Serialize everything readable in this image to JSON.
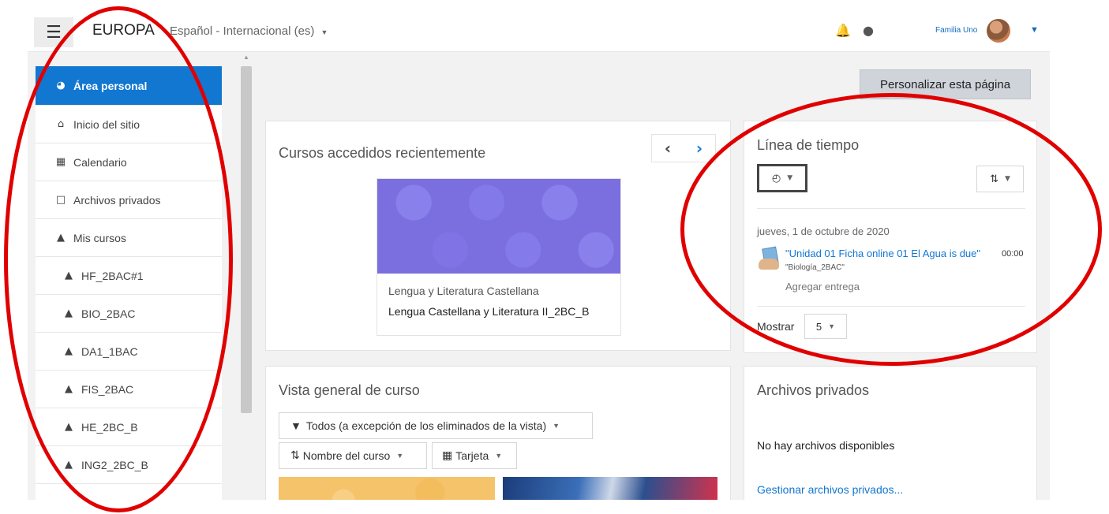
{
  "topbar": {
    "menu_icon": "hamburger-icon",
    "site_name": "EUROPA",
    "language": "Español - Internacional (es)",
    "notifications_icon": "bell-icon",
    "messages_icon": "chat-icon",
    "user_name": "Familia Uno"
  },
  "nav": {
    "items": [
      {
        "label": "Área personal",
        "icon": "dashboard-icon",
        "active": true
      },
      {
        "label": "Inicio del sitio",
        "icon": "home-icon"
      },
      {
        "label": "Calendario",
        "icon": "calendar-icon"
      },
      {
        "label": "Archivos privados",
        "icon": "file-icon"
      },
      {
        "label": "Mis cursos",
        "icon": "graduation-cap-icon"
      },
      {
        "label": "HF_2BAC#1",
        "icon": "graduation-cap-icon"
      },
      {
        "label": "BIO_2BAC",
        "icon": "graduation-cap-icon"
      },
      {
        "label": "DA1_1BAC",
        "icon": "graduation-cap-icon"
      },
      {
        "label": "FIS_2BAC",
        "icon": "graduation-cap-icon"
      },
      {
        "label": "HE_2BC_B",
        "icon": "graduation-cap-icon"
      },
      {
        "label": "ING2_2BC_B",
        "icon": "graduation-cap-icon"
      }
    ]
  },
  "page": {
    "customize_button": "Personalizar esta página"
  },
  "recent_courses": {
    "title": "Cursos accedidos recientemente",
    "course": {
      "category": "Lengua y Literatura Castellana",
      "name": "Lengua Castellana y Literatura II_2BC_B",
      "image_color": "#7b6fe0"
    }
  },
  "timeline": {
    "title": "Línea de tiempo",
    "filter_icon": "clock-icon",
    "sort_icon": "sort-icon",
    "date": "jueves, 1 de octubre de 2020",
    "event": {
      "name": "\"Unidad 01 Ficha online 01 El Agua is due\"",
      "time": "00:00",
      "course": "\"Biología_2BAC\"",
      "action": "Agregar entrega"
    },
    "show_label": "Mostrar",
    "show_value": "5"
  },
  "course_overview": {
    "title": "Vista general de curso",
    "filter": "Todos (a excepción de los eliminados de la vista)",
    "sort": "Nombre del curso",
    "view": "Tarjeta"
  },
  "private_files": {
    "title": "Archivos privados",
    "empty": "No hay archivos disponibles",
    "manage_link": "Gestionar archivos privados..."
  },
  "colors": {
    "primary": "#1177d1",
    "annotation": "#e00000",
    "background": "#f2f2f2"
  }
}
